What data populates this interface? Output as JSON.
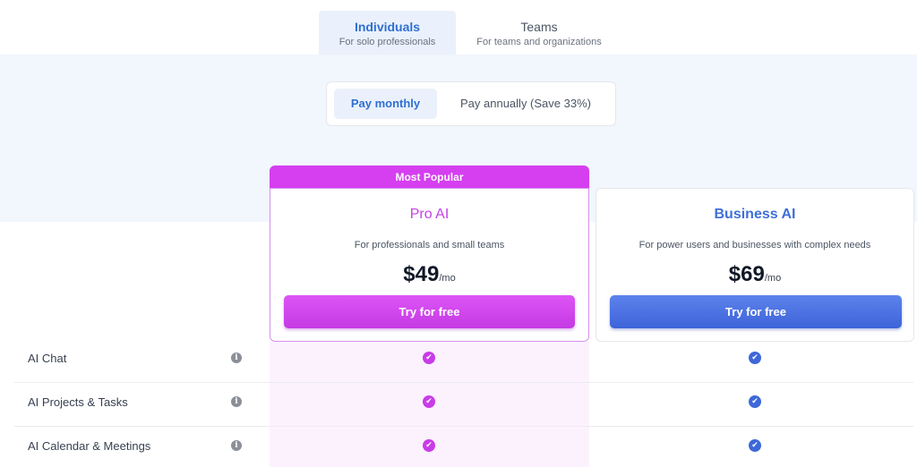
{
  "audience_tabs": [
    {
      "title": "Individuals",
      "subtitle": "For solo professionals",
      "selected": true
    },
    {
      "title": "Teams",
      "subtitle": "For teams and organizations",
      "selected": false
    }
  ],
  "billing": {
    "monthly": "Pay monthly",
    "annual": "Pay annually (Save 33%)",
    "selected": "monthly"
  },
  "plans": [
    {
      "badge": "Most Popular",
      "name": "Pro AI",
      "description": "For professionals and small teams",
      "price": "$49",
      "period": "/mo",
      "cta": "Try for free",
      "accent": "#d53ff0"
    },
    {
      "name": "Business AI",
      "description": "For power users and businesses with complex needs",
      "price": "$69",
      "period": "/mo",
      "cta": "Try for free",
      "accent": "#3e68d8"
    }
  ],
  "features": [
    {
      "label": "AI Chat",
      "pro": true,
      "business": true
    },
    {
      "label": "AI Projects & Tasks",
      "pro": true,
      "business": true
    },
    {
      "label": "AI Calendar & Meetings",
      "pro": true,
      "business": true
    }
  ],
  "icons": {
    "info": "info-icon",
    "check": "check-circle-icon"
  }
}
